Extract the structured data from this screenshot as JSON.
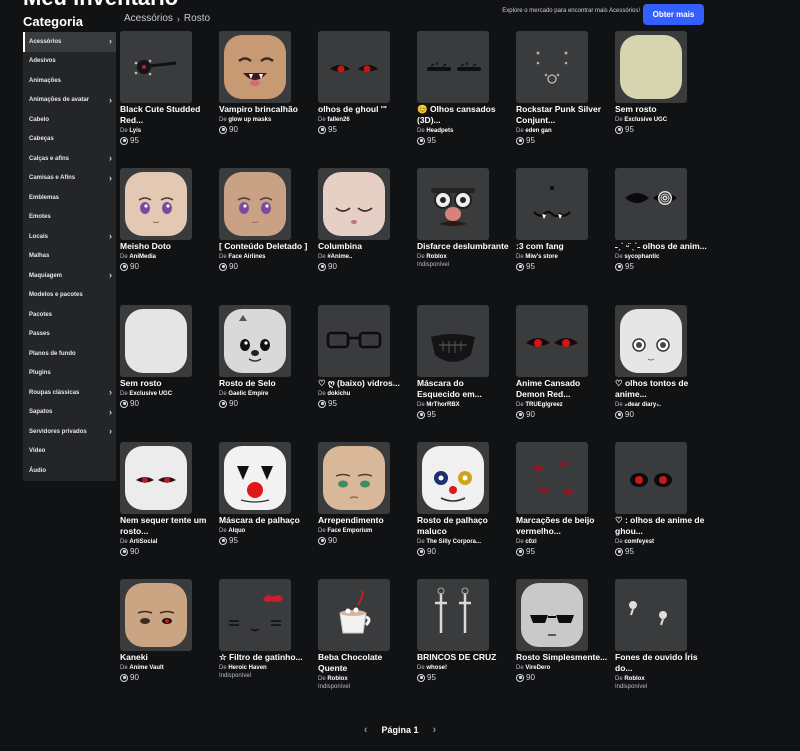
{
  "header": {
    "title": "Meu inventário",
    "sidebar_title": "Categoria",
    "breadcrumb": [
      "Acessórios",
      "Rosto"
    ],
    "explore_text": "Explore o mercado para encontrar mais Acessórios!",
    "get_more_label": "Obter mais"
  },
  "sidebar": {
    "items": [
      {
        "label": "Acessórios",
        "chevron": true,
        "active": true
      },
      {
        "label": "Adesivos",
        "chevron": false
      },
      {
        "label": "Animações",
        "chevron": false
      },
      {
        "label": "Animações de avatar",
        "chevron": true
      },
      {
        "label": "Cabelo",
        "chevron": false
      },
      {
        "label": "Cabeças",
        "chevron": false
      },
      {
        "label": "Calças e afins",
        "chevron": true
      },
      {
        "label": "Camisas e Afins",
        "chevron": true
      },
      {
        "label": "Emblemas",
        "chevron": false
      },
      {
        "label": "Emotes",
        "chevron": false
      },
      {
        "label": "Locais",
        "chevron": true
      },
      {
        "label": "Malhas",
        "chevron": false
      },
      {
        "label": "Maquiagem",
        "chevron": true
      },
      {
        "label": "Modelos e pacotes",
        "chevron": false
      },
      {
        "label": "Pacotes",
        "chevron": false
      },
      {
        "label": "Passes",
        "chevron": false
      },
      {
        "label": "Planos de fundo",
        "chevron": false
      },
      {
        "label": "Plugins",
        "chevron": false
      },
      {
        "label": "Roupas clássicas",
        "chevron": true
      },
      {
        "label": "Sapatos",
        "chevron": true
      },
      {
        "label": "Servidores privados",
        "chevron": true
      },
      {
        "label": "Vídeo",
        "chevron": false
      },
      {
        "label": "Áudio",
        "chevron": false
      }
    ]
  },
  "items": [
    {
      "name": "Black Cute Studded Red...",
      "creator": "Lyis",
      "price": "95",
      "thumb": "studs",
      "color": "#202226"
    },
    {
      "name": "Vampiro brincalhão",
      "creator": "glow up masks",
      "price": "90",
      "thumb": "vampire",
      "color": "#c79a74"
    },
    {
      "name": "olhos de ghoul '\"",
      "creator": "fallen26",
      "price": "95",
      "thumb": "redeyes",
      "color": "#393b3d"
    },
    {
      "name": "😊 Olhos cansados (3D)...",
      "creator": "Headpets",
      "price": "95",
      "thumb": "tired",
      "color": "#393b3d"
    },
    {
      "name": "Rockstar Punk Silver Conjunt...",
      "creator": "eden gan",
      "price": "95",
      "thumb": "punk",
      "color": "#393b3d"
    },
    {
      "name": "Sem rosto",
      "creator": "Exclusive UGC",
      "price": "95",
      "thumb": "blank",
      "color": "#d7d4b0"
    },
    {
      "name": "Meisho Doto",
      "creator": "AniMedia",
      "price": "90",
      "thumb": "anime",
      "color": "#e3c8b3"
    },
    {
      "name": "[ Conteúdo Deletado ]",
      "creator": "Face Airlines",
      "price": "90",
      "thumb": "anime",
      "color": "#c9a184"
    },
    {
      "name": "Columbina",
      "creator": "#Anime..",
      "price": "90",
      "thumb": "columbina",
      "color": "#e6cfc4"
    },
    {
      "name": "Disfarce deslumbrante",
      "creator": "Roblox",
      "price": "",
      "unavailable": "Indisponível",
      "thumb": "disguise",
      "color": "#393b3d"
    },
    {
      "name": ":3 com fang",
      "creator": "Miw's store",
      "price": "95",
      "thumb": "fang",
      "color": "#393b3d"
    },
    {
      "name": "˗ˏˋ ᵕ̈ ˎˊ˗ olhos de anim...",
      "creator": "sycophantic",
      "price": "95",
      "thumb": "spiral",
      "color": "#393b3d"
    },
    {
      "name": "Sem rosto",
      "creator": "Exclusive UGC",
      "price": "90",
      "thumb": "blank",
      "color": "#e5e5e5"
    },
    {
      "name": "Rosto de Selo",
      "creator": "Gaelic Empire",
      "price": "90",
      "thumb": "seal",
      "color": "#d9d9d9"
    },
    {
      "name": "♡ ღ (baixo) vidros...",
      "creator": "dokichu",
      "price": "95",
      "thumb": "glasses",
      "color": "#393b3d"
    },
    {
      "name": "Máscara do Esquecido em...",
      "creator": "MrThorRBX",
      "price": "95",
      "thumb": "mask",
      "color": "#393b3d"
    },
    {
      "name": "Anime Cansado Demon Red...",
      "creator": "TRUEglgreez",
      "price": "90",
      "thumb": "demon",
      "color": "#393b3d"
    },
    {
      "name": "♡ olhos tontos de anime...",
      "creator": "₊dear diary₊.",
      "price": "90",
      "thumb": "dizzy",
      "color": "#e6e6e6"
    },
    {
      "name": "Nem sequer tente um rosto...",
      "creator": "ArtiSocial",
      "price": "90",
      "thumb": "notry",
      "color": "#ececec"
    },
    {
      "name": "Máscara de palhaço",
      "creator": "Alquo",
      "price": "95",
      "thumb": "clown",
      "color": "#f2f2f2"
    },
    {
      "name": "Arrependimento",
      "creator": "Face Emporium",
      "price": "90",
      "thumb": "regret",
      "color": "#d9b89a"
    },
    {
      "name": "Rosto de palhaço maluco",
      "creator": "The Silly Corpora...",
      "price": "90",
      "thumb": "crazyclown",
      "color": "#f0f0f0"
    },
    {
      "name": "Marcações de beijo vermelho...",
      "creator": "c0zi",
      "price": "95",
      "thumb": "kiss",
      "color": "#393b3d"
    },
    {
      "name": "♡ : olhos de anime de ghou...",
      "creator": "comfeyest",
      "price": "95",
      "thumb": "ghoul2",
      "color": "#393b3d"
    },
    {
      "name": "Kaneki",
      "creator": "Anime Vault",
      "price": "90",
      "thumb": "kaneki",
      "color": "#c9a584"
    },
    {
      "name": "☆ Filtro de gatinho...",
      "creator": "Heroic Haven",
      "price": "",
      "unavailable": "Indisponível",
      "thumb": "kitty",
      "color": "#393b3d"
    },
    {
      "name": "Beba Chocolate Quente",
      "creator": "Roblox",
      "price": "",
      "unavailable": "Indisponível",
      "thumb": "cocoa",
      "color": "#393b3d"
    },
    {
      "name": "BRINCOS DE CRUZ",
      "creator": "whose!",
      "price": "95",
      "thumb": "cross",
      "color": "#393b3d"
    },
    {
      "name": "Rosto Simplesmente...",
      "creator": "VireDero",
      "price": "90",
      "thumb": "shades",
      "color": "#c9c9c9"
    },
    {
      "name": "Fones de ouvido Íris do...",
      "creator": "Roblox",
      "price": "",
      "unavailable": "Indisponível",
      "thumb": "earbuds",
      "color": "#393b3d"
    }
  ],
  "labels": {
    "creator_prefix": "De "
  },
  "pagination": {
    "label": "Página 1",
    "prev": "‹",
    "next": "›"
  }
}
